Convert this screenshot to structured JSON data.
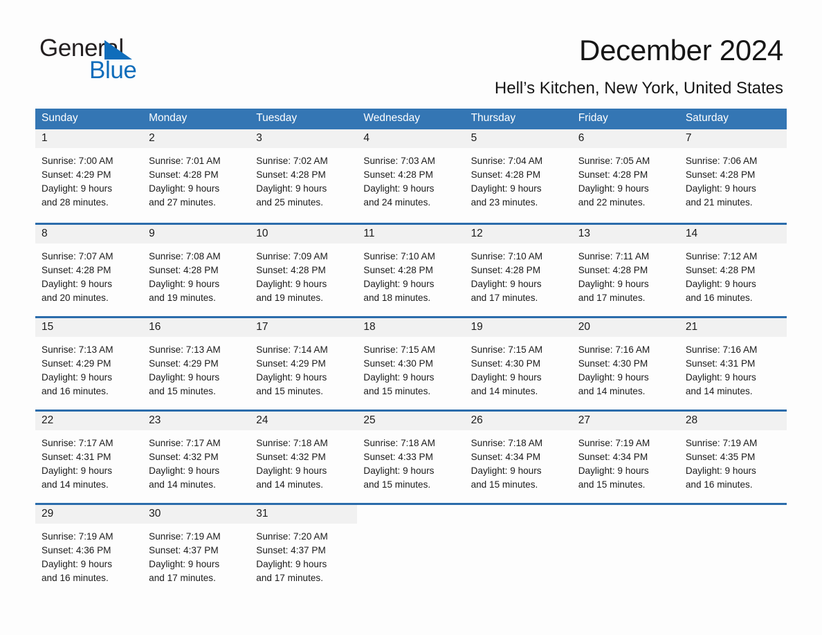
{
  "brand": {
    "name_part1": "General",
    "name_part2": "Blue",
    "triangle_icon": "triangle-icon",
    "accent_color": "#0f6dbb"
  },
  "header": {
    "title": "December 2024",
    "subtitle": "Hell’s Kitchen, New York, United States"
  },
  "calendar": {
    "header_bg": "#3476b4",
    "rule_color": "#2b6cab",
    "daynum_bg": "#f1f1f1",
    "weekday_headers": [
      "Sunday",
      "Monday",
      "Tuesday",
      "Wednesday",
      "Thursday",
      "Friday",
      "Saturday"
    ],
    "weeks": [
      [
        {
          "day": "1",
          "sunrise": "Sunrise: 7:00 AM",
          "sunset": "Sunset: 4:29 PM",
          "daylight1": "Daylight: 9 hours",
          "daylight2": "and 28 minutes."
        },
        {
          "day": "2",
          "sunrise": "Sunrise: 7:01 AM",
          "sunset": "Sunset: 4:28 PM",
          "daylight1": "Daylight: 9 hours",
          "daylight2": "and 27 minutes."
        },
        {
          "day": "3",
          "sunrise": "Sunrise: 7:02 AM",
          "sunset": "Sunset: 4:28 PM",
          "daylight1": "Daylight: 9 hours",
          "daylight2": "and 25 minutes."
        },
        {
          "day": "4",
          "sunrise": "Sunrise: 7:03 AM",
          "sunset": "Sunset: 4:28 PM",
          "daylight1": "Daylight: 9 hours",
          "daylight2": "and 24 minutes."
        },
        {
          "day": "5",
          "sunrise": "Sunrise: 7:04 AM",
          "sunset": "Sunset: 4:28 PM",
          "daylight1": "Daylight: 9 hours",
          "daylight2": "and 23 minutes."
        },
        {
          "day": "6",
          "sunrise": "Sunrise: 7:05 AM",
          "sunset": "Sunset: 4:28 PM",
          "daylight1": "Daylight: 9 hours",
          "daylight2": "and 22 minutes."
        },
        {
          "day": "7",
          "sunrise": "Sunrise: 7:06 AM",
          "sunset": "Sunset: 4:28 PM",
          "daylight1": "Daylight: 9 hours",
          "daylight2": "and 21 minutes."
        }
      ],
      [
        {
          "day": "8",
          "sunrise": "Sunrise: 7:07 AM",
          "sunset": "Sunset: 4:28 PM",
          "daylight1": "Daylight: 9 hours",
          "daylight2": "and 20 minutes."
        },
        {
          "day": "9",
          "sunrise": "Sunrise: 7:08 AM",
          "sunset": "Sunset: 4:28 PM",
          "daylight1": "Daylight: 9 hours",
          "daylight2": "and 19 minutes."
        },
        {
          "day": "10",
          "sunrise": "Sunrise: 7:09 AM",
          "sunset": "Sunset: 4:28 PM",
          "daylight1": "Daylight: 9 hours",
          "daylight2": "and 19 minutes."
        },
        {
          "day": "11",
          "sunrise": "Sunrise: 7:10 AM",
          "sunset": "Sunset: 4:28 PM",
          "daylight1": "Daylight: 9 hours",
          "daylight2": "and 18 minutes."
        },
        {
          "day": "12",
          "sunrise": "Sunrise: 7:10 AM",
          "sunset": "Sunset: 4:28 PM",
          "daylight1": "Daylight: 9 hours",
          "daylight2": "and 17 minutes."
        },
        {
          "day": "13",
          "sunrise": "Sunrise: 7:11 AM",
          "sunset": "Sunset: 4:28 PM",
          "daylight1": "Daylight: 9 hours",
          "daylight2": "and 17 minutes."
        },
        {
          "day": "14",
          "sunrise": "Sunrise: 7:12 AM",
          "sunset": "Sunset: 4:28 PM",
          "daylight1": "Daylight: 9 hours",
          "daylight2": "and 16 minutes."
        }
      ],
      [
        {
          "day": "15",
          "sunrise": "Sunrise: 7:13 AM",
          "sunset": "Sunset: 4:29 PM",
          "daylight1": "Daylight: 9 hours",
          "daylight2": "and 16 minutes."
        },
        {
          "day": "16",
          "sunrise": "Sunrise: 7:13 AM",
          "sunset": "Sunset: 4:29 PM",
          "daylight1": "Daylight: 9 hours",
          "daylight2": "and 15 minutes."
        },
        {
          "day": "17",
          "sunrise": "Sunrise: 7:14 AM",
          "sunset": "Sunset: 4:29 PM",
          "daylight1": "Daylight: 9 hours",
          "daylight2": "and 15 minutes."
        },
        {
          "day": "18",
          "sunrise": "Sunrise: 7:15 AM",
          "sunset": "Sunset: 4:30 PM",
          "daylight1": "Daylight: 9 hours",
          "daylight2": "and 15 minutes."
        },
        {
          "day": "19",
          "sunrise": "Sunrise: 7:15 AM",
          "sunset": "Sunset: 4:30 PM",
          "daylight1": "Daylight: 9 hours",
          "daylight2": "and 14 minutes."
        },
        {
          "day": "20",
          "sunrise": "Sunrise: 7:16 AM",
          "sunset": "Sunset: 4:30 PM",
          "daylight1": "Daylight: 9 hours",
          "daylight2": "and 14 minutes."
        },
        {
          "day": "21",
          "sunrise": "Sunrise: 7:16 AM",
          "sunset": "Sunset: 4:31 PM",
          "daylight1": "Daylight: 9 hours",
          "daylight2": "and 14 minutes."
        }
      ],
      [
        {
          "day": "22",
          "sunrise": "Sunrise: 7:17 AM",
          "sunset": "Sunset: 4:31 PM",
          "daylight1": "Daylight: 9 hours",
          "daylight2": "and 14 minutes."
        },
        {
          "day": "23",
          "sunrise": "Sunrise: 7:17 AM",
          "sunset": "Sunset: 4:32 PM",
          "daylight1": "Daylight: 9 hours",
          "daylight2": "and 14 minutes."
        },
        {
          "day": "24",
          "sunrise": "Sunrise: 7:18 AM",
          "sunset": "Sunset: 4:32 PM",
          "daylight1": "Daylight: 9 hours",
          "daylight2": "and 14 minutes."
        },
        {
          "day": "25",
          "sunrise": "Sunrise: 7:18 AM",
          "sunset": "Sunset: 4:33 PM",
          "daylight1": "Daylight: 9 hours",
          "daylight2": "and 15 minutes."
        },
        {
          "day": "26",
          "sunrise": "Sunrise: 7:18 AM",
          "sunset": "Sunset: 4:34 PM",
          "daylight1": "Daylight: 9 hours",
          "daylight2": "and 15 minutes."
        },
        {
          "day": "27",
          "sunrise": "Sunrise: 7:19 AM",
          "sunset": "Sunset: 4:34 PM",
          "daylight1": "Daylight: 9 hours",
          "daylight2": "and 15 minutes."
        },
        {
          "day": "28",
          "sunrise": "Sunrise: 7:19 AM",
          "sunset": "Sunset: 4:35 PM",
          "daylight1": "Daylight: 9 hours",
          "daylight2": "and 16 minutes."
        }
      ],
      [
        {
          "day": "29",
          "sunrise": "Sunrise: 7:19 AM",
          "sunset": "Sunset: 4:36 PM",
          "daylight1": "Daylight: 9 hours",
          "daylight2": "and 16 minutes."
        },
        {
          "day": "30",
          "sunrise": "Sunrise: 7:19 AM",
          "sunset": "Sunset: 4:37 PM",
          "daylight1": "Daylight: 9 hours",
          "daylight2": "and 17 minutes."
        },
        {
          "day": "31",
          "sunrise": "Sunrise: 7:20 AM",
          "sunset": "Sunset: 4:37 PM",
          "daylight1": "Daylight: 9 hours",
          "daylight2": "and 17 minutes."
        },
        {
          "day": "",
          "sunrise": "",
          "sunset": "",
          "daylight1": "",
          "daylight2": ""
        },
        {
          "day": "",
          "sunrise": "",
          "sunset": "",
          "daylight1": "",
          "daylight2": ""
        },
        {
          "day": "",
          "sunrise": "",
          "sunset": "",
          "daylight1": "",
          "daylight2": ""
        },
        {
          "day": "",
          "sunrise": "",
          "sunset": "",
          "daylight1": "",
          "daylight2": ""
        }
      ]
    ]
  }
}
